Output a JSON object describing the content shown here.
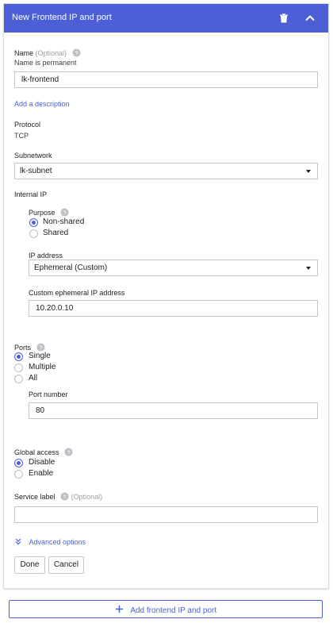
{
  "header": {
    "title": "New Frontend IP and port",
    "delete_icon": "trash-icon",
    "collapse_icon": "chevron-up-icon"
  },
  "name": {
    "label": "Name",
    "optional": "(Optional)",
    "note": "Name is permanent",
    "value": "lk-frontend"
  },
  "add_description": "Add a description",
  "protocol": {
    "label": "Protocol",
    "value": "TCP"
  },
  "subnetwork": {
    "label": "Subnetwork",
    "value": "lk-subnet"
  },
  "internal_ip": {
    "label": "Internal IP",
    "purpose": {
      "label": "Purpose",
      "options": [
        "Non-shared",
        "Shared"
      ],
      "selected": "Non-shared"
    },
    "ip_address": {
      "label": "IP address",
      "value": "Ephemeral (Custom)"
    },
    "custom_ephemeral": {
      "label": "Custom ephemeral IP address",
      "value": "10.20.0.10"
    }
  },
  "ports": {
    "label": "Ports",
    "options": [
      "Single",
      "Multiple",
      "All"
    ],
    "selected": "Single",
    "port_number": {
      "label": "Port number",
      "value": "80"
    }
  },
  "global_access": {
    "label": "Global access",
    "options": [
      "Disable",
      "Enable"
    ],
    "selected": "Disable"
  },
  "service_label": {
    "label": "Service label",
    "optional": "(Optional)",
    "value": ""
  },
  "advanced_options": "Advanced options",
  "buttons": {
    "done": "Done",
    "cancel": "Cancel"
  },
  "add_frontend": "Add frontend IP and port",
  "colors": {
    "accent": "#4d5fd6",
    "border": "#c5c7cb"
  }
}
